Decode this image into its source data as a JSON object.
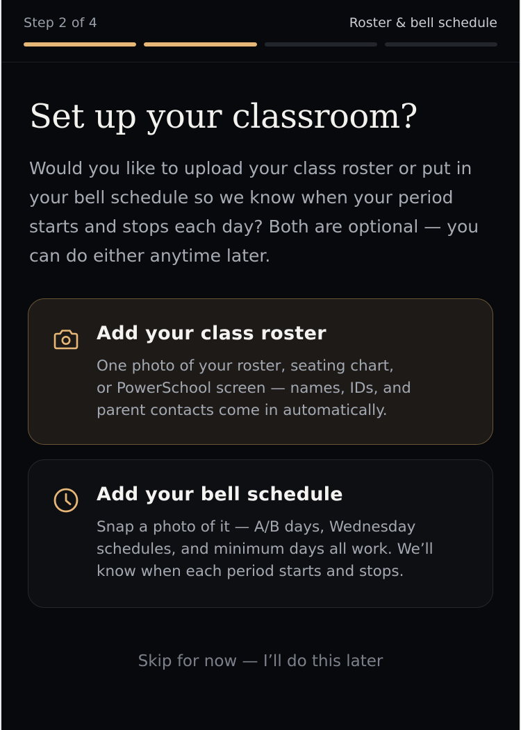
{
  "header": {
    "step": "Step 2 of 4",
    "title": "Roster & bell schedule",
    "progress": {
      "total_steps": 4,
      "completed": 2
    }
  },
  "main": {
    "heading": "Set up your classroom?",
    "intro": "Would you like to upload your class roster or put in your bell schedule so we know when your period starts and stops each day? Both are optional — you can do either anytime later.",
    "options": [
      {
        "icon": "camera-icon",
        "title": "Add your class roster",
        "description_lines": [
          "One photo of your roster, seating chart,",
          "or PowerSchool screen — names, IDs, and",
          "parent contacts come in automatically."
        ]
      },
      {
        "icon": "clock-icon",
        "title": "Add your bell schedule",
        "description_lines": [
          "Snap a photo of it — A/B days, Wednesday",
          "schedules, and minimum days all work. We’ll",
          "know when each period starts and stops."
        ]
      }
    ],
    "skip_label": "Skip for now — I’ll do this later"
  },
  "colors": {
    "accent": "#e7b777",
    "background": "#08090c",
    "card_highlight": "#1d1a18",
    "card": "#0e0f13"
  }
}
